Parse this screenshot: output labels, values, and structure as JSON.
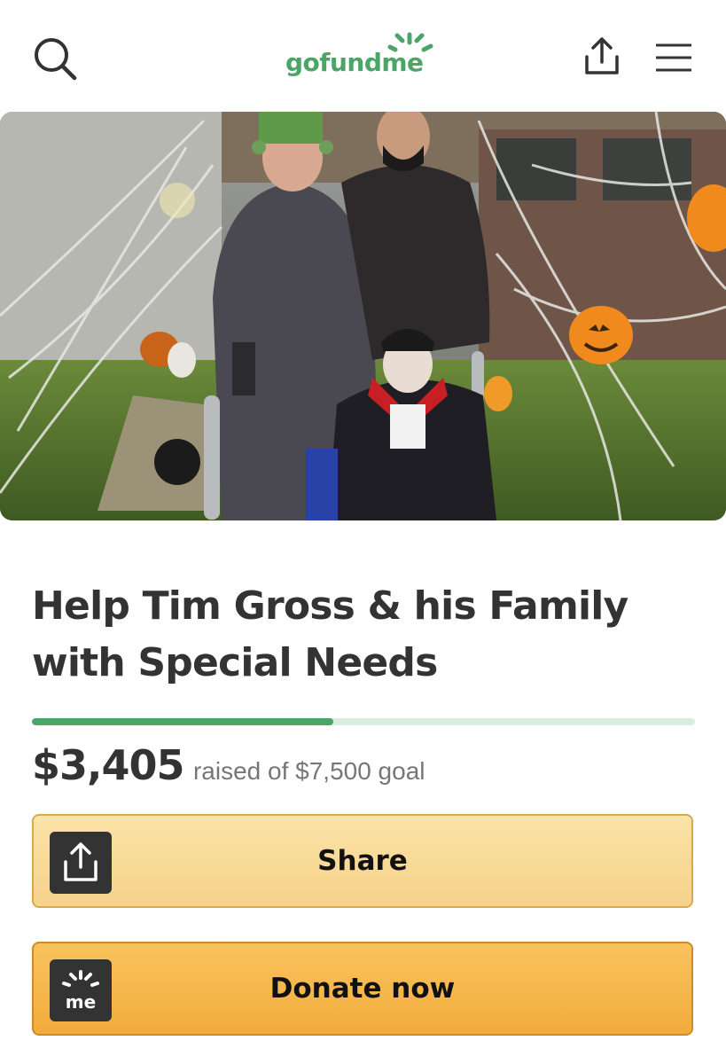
{
  "header": {
    "logo_text": "gofundme",
    "icons": {
      "search": "search-icon",
      "share": "share-upload-icon",
      "menu": "hamburger-menu-icon"
    },
    "brand_color": "#4aa567"
  },
  "campaign": {
    "title": "Help Tim Gross & his Family with Special Needs",
    "raised_amount": "$3,405",
    "goal_text": "raised of $7,500 goal",
    "progress_percent": 45.4
  },
  "actions": {
    "share_label": "Share",
    "donate_label": "Donate now",
    "donate_badge": "me"
  },
  "colors": {
    "progress_fill": "#4aa567",
    "progress_track": "#d9eedf",
    "share_button": "#f8d997",
    "donate_button": "#f4b54a",
    "text": "#333333"
  }
}
